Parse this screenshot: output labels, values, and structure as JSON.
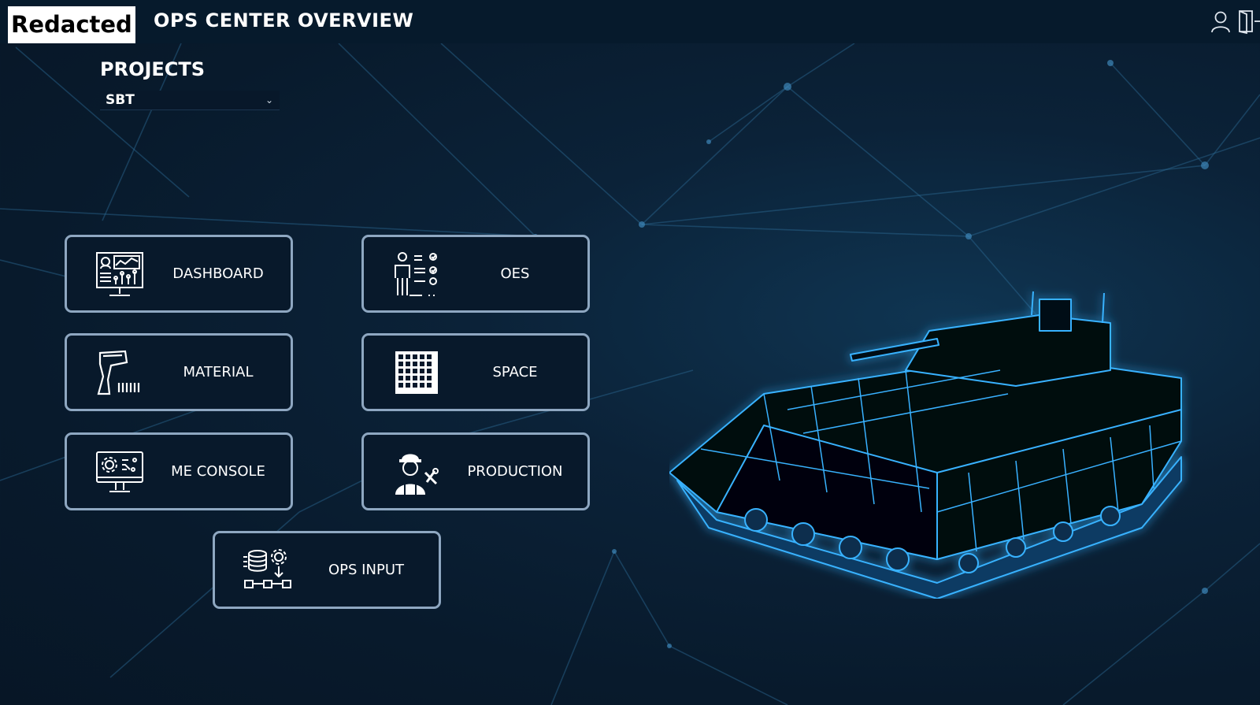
{
  "header": {
    "logo_text": "Redacted",
    "title": "OPS CENTER OVERVIEW",
    "user_icon": "user-icon",
    "exit_icon": "exit-door-icon"
  },
  "projects": {
    "label": "PROJECTS",
    "selected": "SBT",
    "chevron": "⌄"
  },
  "tiles": [
    {
      "label": "DASHBOARD",
      "icon": "dashboard-monitor-icon"
    },
    {
      "label": "OES",
      "icon": "worker-checklist-icon"
    },
    {
      "label": "MATERIAL",
      "icon": "barcode-scanner-icon"
    },
    {
      "label": "SPACE",
      "icon": "grid-icon"
    },
    {
      "label": "ME CONSOLE",
      "icon": "settings-monitor-icon"
    },
    {
      "label": "PRODUCTION",
      "icon": "engineer-tools-icon"
    },
    {
      "label": "OPS INPUT",
      "icon": "database-flow-icon"
    }
  ],
  "colors": {
    "background": "#0b2238",
    "topbar": "#061a2c",
    "tile_border": "#8ea7c1",
    "tile_fill": "#08192b",
    "glow": "#2fa8ff"
  }
}
